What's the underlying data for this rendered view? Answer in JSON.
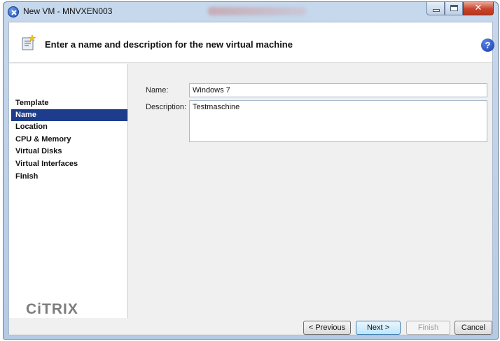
{
  "window": {
    "title": "New VM - MNVXEN003"
  },
  "header": {
    "title": "Enter a name and description for the new virtual machine",
    "icon": "wizard-page-icon",
    "help_icon": "help-icon",
    "help_glyph": "?"
  },
  "sidebar": {
    "items": [
      {
        "label": "Template",
        "selected": false
      },
      {
        "label": "Name",
        "selected": true
      },
      {
        "label": "Location",
        "selected": false
      },
      {
        "label": "CPU & Memory",
        "selected": false
      },
      {
        "label": "Virtual Disks",
        "selected": false
      },
      {
        "label": "Virtual Interfaces",
        "selected": false
      },
      {
        "label": "Finish",
        "selected": false
      }
    ],
    "logo": "CiTRIX"
  },
  "form": {
    "name_label": "Name:",
    "name_value": "Windows 7",
    "description_label": "Description:",
    "description_value": "Testmaschine"
  },
  "footer": {
    "previous": "< Previous",
    "next": "Next >",
    "finish": "Finish",
    "cancel": "Cancel"
  },
  "colors": {
    "selected_nav": "#1e3c8c",
    "logo": "#7d7d7d"
  }
}
